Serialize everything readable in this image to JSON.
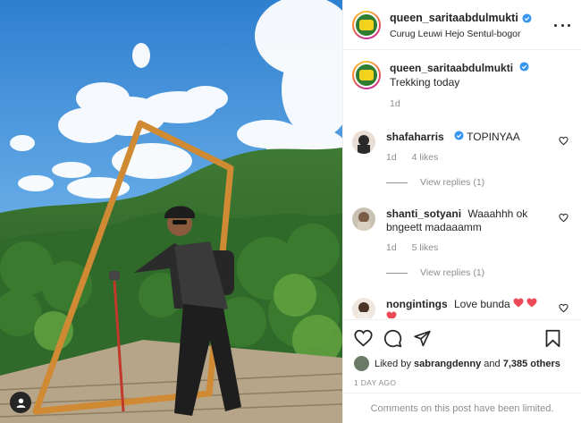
{
  "post": {
    "username": "queen_sarita abdulmukti",
    "location": "Curug Leuwi Hejo Sentul-bogor",
    "caption_user": "queen_saritaabdulmukti",
    "caption_text": "Trekking today",
    "caption_age": "1d"
  },
  "comments": [
    {
      "user": "shafaharris",
      "text": "TOPINYAA",
      "verified": true,
      "age": "1d",
      "likes": "4 likes",
      "replies": "View replies (1)"
    },
    {
      "user": "shanti_sotyani",
      "text": "Waaahhh ok bngeett madaaamm",
      "verified": false,
      "age": "1d",
      "likes": "5 likes",
      "replies": "View replies (1)"
    },
    {
      "user": "nongintings",
      "text": "Love bunda",
      "verified": false
    }
  ],
  "likes": {
    "prefix": "Liked by",
    "user": "sabrangdenny",
    "joiner": "and",
    "count": "7,385 others"
  },
  "timestamp": "1 DAY AGO",
  "limited_notice": "Comments on this post have been limited.",
  "colors": {
    "verified": "#3897f0",
    "heart": "#ed4956",
    "muted": "#8e8e8e"
  },
  "icons": [
    "more-icon",
    "heart-icon",
    "comment-icon",
    "share-icon",
    "bookmark-icon",
    "user-tag-icon",
    "verified-icon"
  ]
}
